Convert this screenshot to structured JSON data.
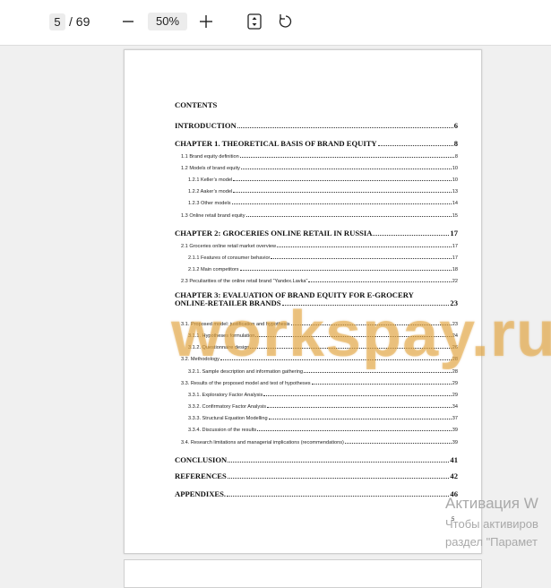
{
  "toolbar": {
    "current_page": "5",
    "total_pages": "/ 69",
    "zoom_level": "50%",
    "icons": [
      "minus-icon",
      "plus-icon",
      "fit-page-icon",
      "rotate-icon"
    ]
  },
  "document": {
    "contents_title": "CONTENTS",
    "page_number": "5",
    "toc": [
      {
        "type": "h",
        "title": "INTRODUCTION",
        "page": "6"
      },
      {
        "type": "h",
        "title": "CHAPTER 1. THEORETICAL BASIS OF BRAND EQUITY",
        "page": "8"
      },
      {
        "type": "s1",
        "title": "1.1 Brand equity definition",
        "page": "8"
      },
      {
        "type": "s1",
        "title": "1.2 Models of brand equity",
        "page": "10"
      },
      {
        "type": "s2",
        "title": "1.2.1 Keller’s model",
        "page": "10"
      },
      {
        "type": "s2",
        "title": "1.2.2 Aaker’s model",
        "page": "13"
      },
      {
        "type": "s2",
        "title": "1.2.3 Other models",
        "page": "14"
      },
      {
        "type": "s1",
        "title": "1.3 Online retail brand equity",
        "page": "15"
      },
      {
        "type": "h",
        "title": "CHAPTER 2: GROCERIES ONLINE RETAIL IN RUSSIA",
        "page": "17"
      },
      {
        "type": "s1",
        "title": "2.1 Groceries online retail market overview",
        "page": "17"
      },
      {
        "type": "s2",
        "title": "2.1.1 Features of consumer behavior",
        "page": "17"
      },
      {
        "type": "s2",
        "title": "2.1.2 Main competitors",
        "page": "18"
      },
      {
        "type": "s1",
        "title": "2.3 Peculiarities of the online retail brand “Yandex.Lavka”",
        "page": "22"
      },
      {
        "type": "h2",
        "title": "CHAPTER 3: EVALUATION OF BRAND EQUITY  FOR E-GROCERY",
        "title2": "ONLINE-RETAILER BRANDS",
        "page": "23"
      },
      {
        "type": "s1",
        "title": "3.1. Proposed model: justification and hypothesis",
        "page": "23"
      },
      {
        "type": "s2",
        "title": "3.1.1. Hypotheses formulation",
        "page": "24"
      },
      {
        "type": "s2",
        "title": "3.1.2. Questionnaire design",
        "page": "26"
      },
      {
        "type": "s1",
        "title": "3.2.   Methodology",
        "page": "28"
      },
      {
        "type": "s2",
        "title": "3.2.1. Sample description and information gathering",
        "page": "28"
      },
      {
        "type": "s1",
        "title": "3.3. Results of the proposed model and test of hypotheses",
        "page": "29"
      },
      {
        "type": "s2",
        "title": "3.3.1. Exploratory Factor Analysis",
        "page": "29"
      },
      {
        "type": "s2",
        "title": "3.3.2. Confirmatory Factor Analysis",
        "page": "34"
      },
      {
        "type": "s2",
        "title": "3.3.3. Structural Equation Modelling",
        "page": "37"
      },
      {
        "type": "s2",
        "title": "3.3.4. Discussion of the results",
        "page": "39"
      },
      {
        "type": "s1",
        "title": "3.4. Research limitations and managerial implications (recommendations)",
        "page": "39"
      },
      {
        "type": "h",
        "title": "CONCLUSION",
        "page": "41"
      },
      {
        "type": "h",
        "title": "REFERENCES",
        "page": "42"
      },
      {
        "type": "h",
        "title": "APPENDIXES.",
        "page": "46"
      }
    ]
  },
  "watermark": "workspay.ru",
  "activation": {
    "line1": "Активация W",
    "line2": "Чтобы активиров",
    "line3": "раздел \"Парамет"
  },
  "colors": {
    "toolbar_bg": "#ffffff",
    "viewer_bg": "#f0f0f0",
    "watermark": "#e8aa46"
  }
}
